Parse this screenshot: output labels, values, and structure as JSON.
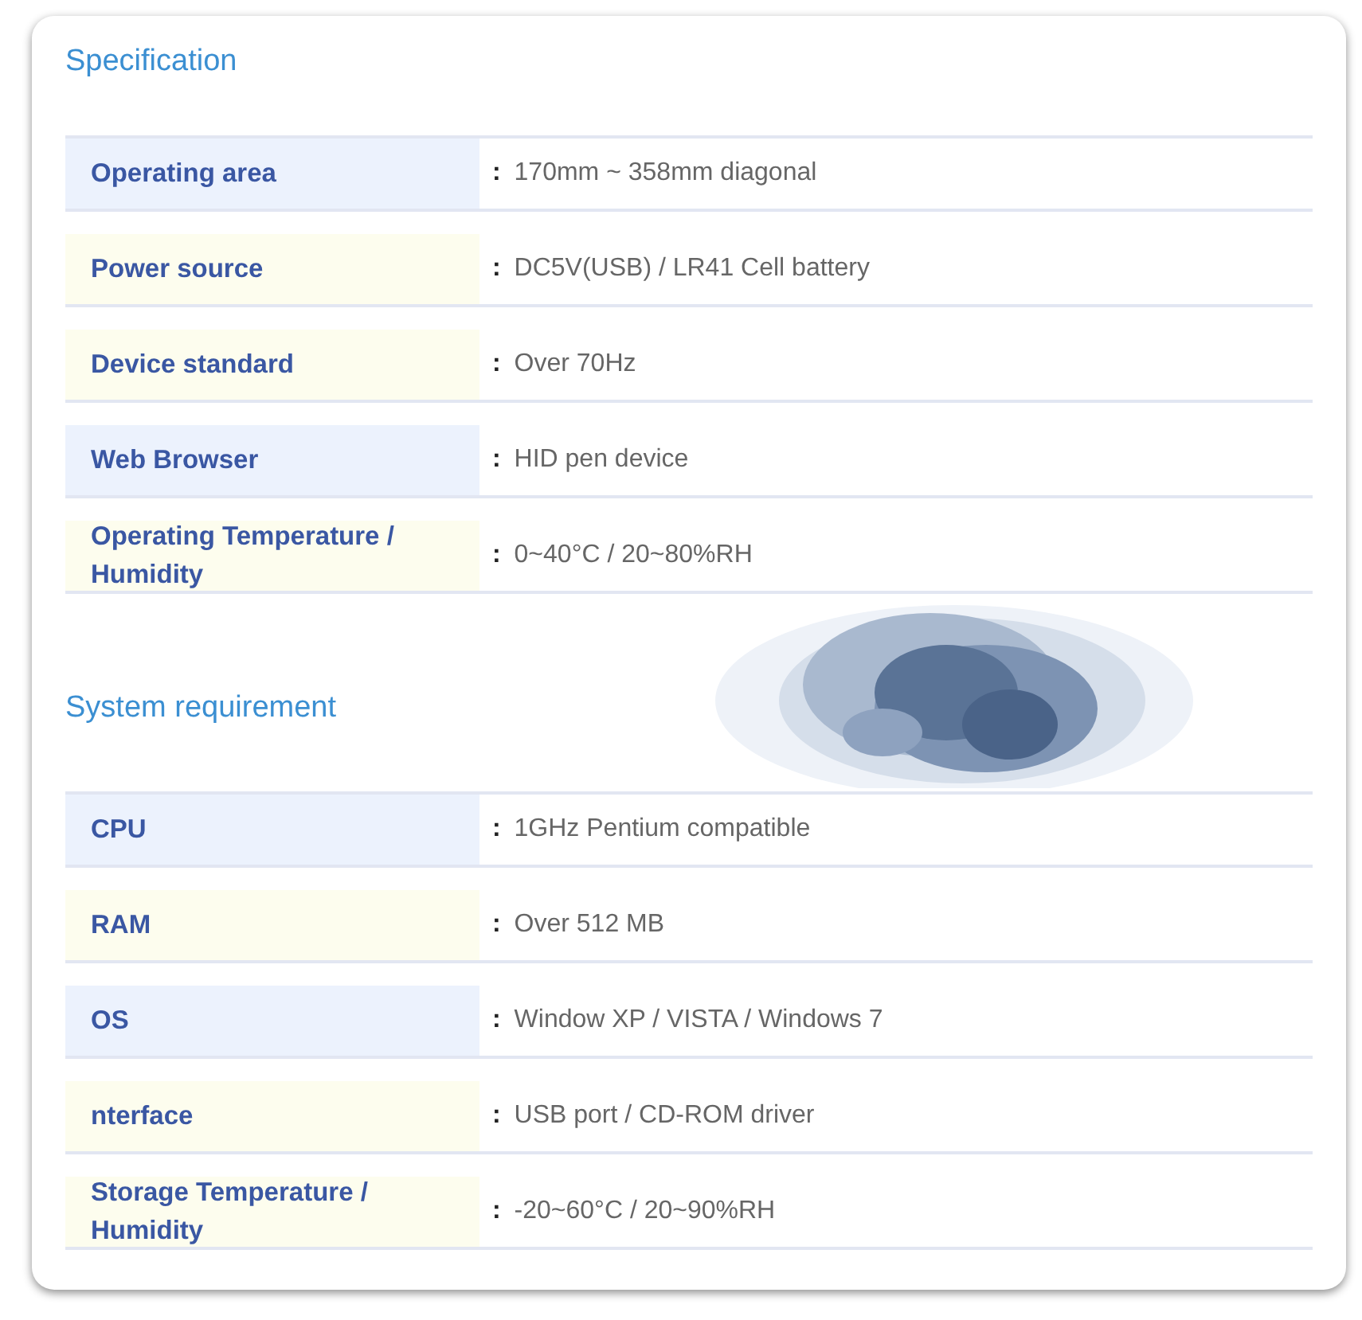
{
  "sections": [
    {
      "title": "Specification",
      "rows": [
        {
          "label": "Operating area",
          "value": "**:** 170mm ~ 358mm diagonal",
          "color": "#ecf2fd"
        },
        {
          "label": "Power source",
          "value": "**:** DC5V(USB) / LR41 Cell battery",
          "color": "#fdfdee"
        },
        {
          "label": "Device standard",
          "value": "**:** Over 70Hz",
          "color": "#fdfdee"
        },
        {
          "label": "Web Browser",
          "value": "**:** HID pen device",
          "color": "#ecf2fd"
        },
        {
          "label": "Operating Temperature / Humidity",
          "value": "**:** 0~40°C / 20~80%RH",
          "color": "#fdfdee"
        }
      ]
    },
    {
      "title": "System requirement",
      "rows": [
        {
          "label": "CPU",
          "value": "**:** 1GHz Pentium compatible",
          "color": "#ecf2fd"
        },
        {
          "label": "RAM",
          "value": "**:** Over 512 MB",
          "color": "#fdfdee"
        },
        {
          "label": "OS",
          "value": "**:** Window XP / VISTA / Windows 7",
          "color": "#ecf2fd"
        },
        {
          "label": "nterface",
          "value": "**:** USB port / CD-ROM driver",
          "color": "#fdfdee"
        },
        {
          "label": "Storage Temperature / Humidity",
          "value": "**:** -20~60°C / 20~90%RH",
          "color": "#fdfdee"
        }
      ]
    }
  ]
}
